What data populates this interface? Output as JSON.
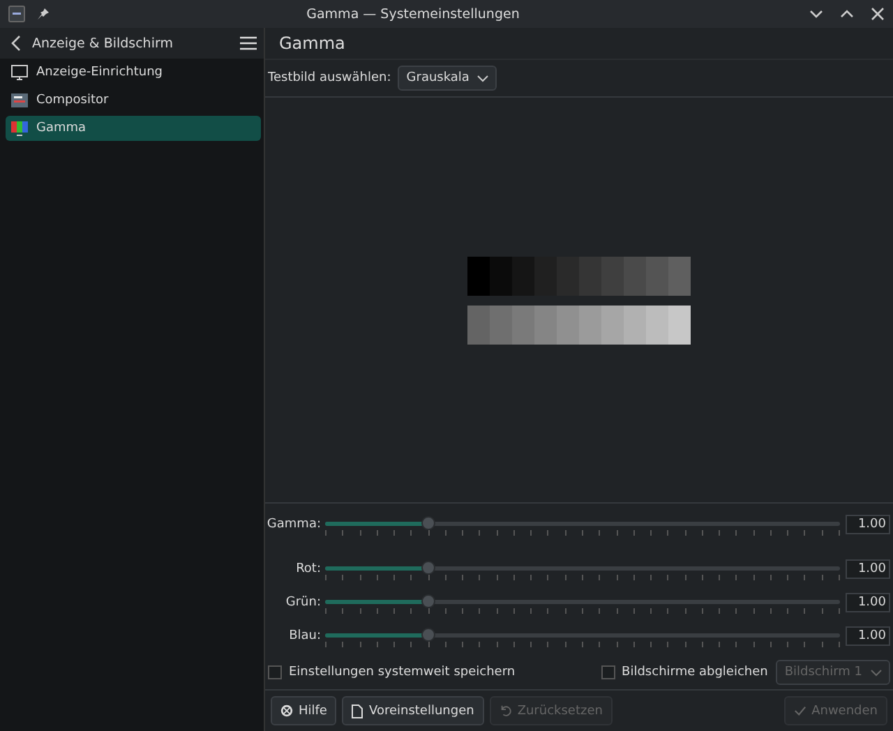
{
  "window": {
    "title": "Gamma — Systemeinstellungen"
  },
  "sidebar": {
    "title": "Anzeige & Bildschirm",
    "items": [
      {
        "label": "Anzeige-Einrichtung",
        "kind": "monitor",
        "selected": false
      },
      {
        "label": "Compositor",
        "kind": "compositor",
        "selected": false
      },
      {
        "label": "Gamma",
        "kind": "gamma",
        "selected": true
      }
    ]
  },
  "page": {
    "title": "Gamma",
    "test_image": {
      "label": "Testbild auswählen:",
      "value": "Grauskala"
    },
    "sliders": [
      {
        "label": "Gamma:",
        "level": 0.2,
        "reading": "1.00"
      },
      {
        "label": "Rot:",
        "level": 0.2,
        "reading": "1.00"
      },
      {
        "label": "Grün:",
        "level": 0.2,
        "reading": "1.00"
      },
      {
        "label": "Blau:",
        "level": 0.2,
        "reading": "1.00"
      }
    ],
    "options": [
      {
        "label": "Einstellungen systemweit speichern",
        "checked": false
      },
      {
        "label": "Bildschirme abgleichen",
        "checked": false
      }
    ],
    "screen_select": {
      "value": "Bildschirm 1",
      "disabled": true
    },
    "buttons": [
      {
        "label": "Hilfe",
        "kind": "help",
        "disabled": false
      },
      {
        "label": "Voreinstellungen",
        "kind": "defaults",
        "disabled": false
      },
      {
        "label": "Zurücksetzen",
        "kind": "reset",
        "disabled": true
      },
      {
        "label": "Anwenden",
        "kind": "apply",
        "disabled": true
      }
    ]
  }
}
